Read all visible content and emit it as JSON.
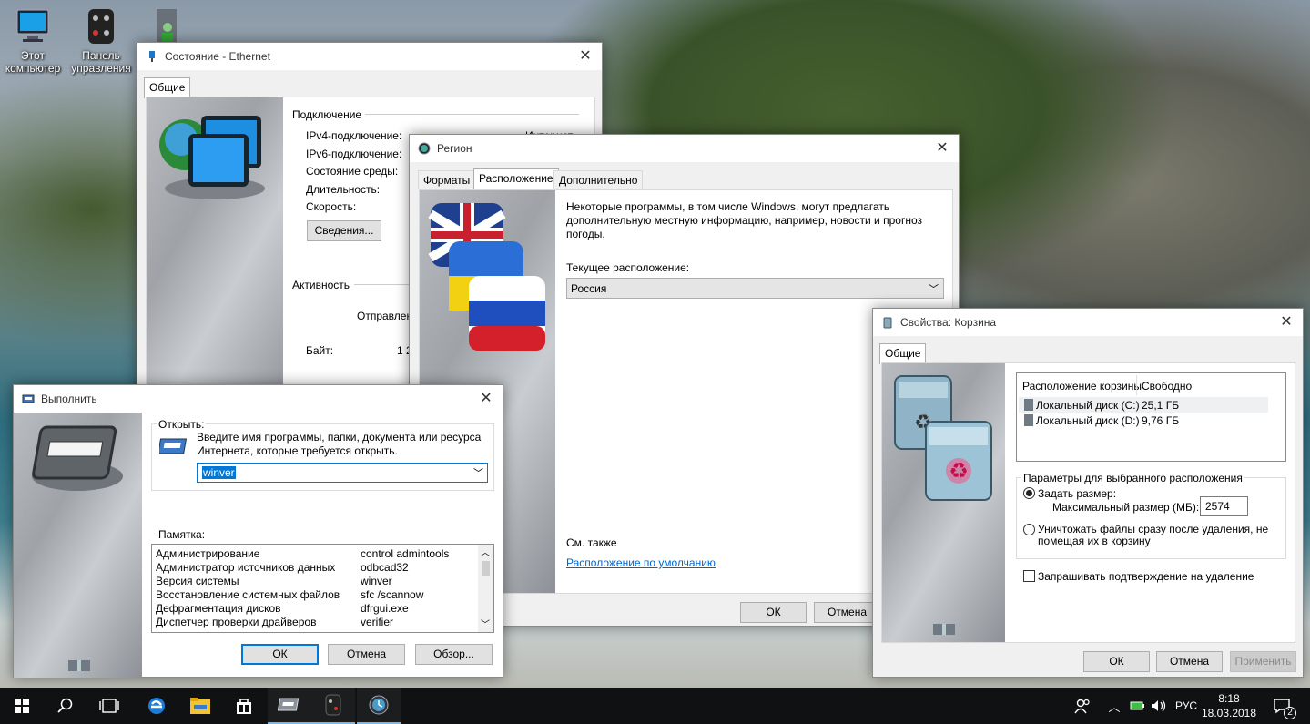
{
  "desktop": {
    "icons": [
      {
        "label": "Этот компьютер"
      },
      {
        "label": "Панель управления"
      },
      {
        "label": ""
      }
    ]
  },
  "ethernet": {
    "title": "Состояние - Ethernet",
    "tab": "Общие",
    "connection_header": "Подключение",
    "rows": [
      {
        "label": "IPv4-подключение:",
        "value": "Интернет"
      },
      {
        "label": "IPv6-подключение:",
        "value": ""
      },
      {
        "label": "Состояние среды:",
        "value": ""
      },
      {
        "label": "Длительность:",
        "value": ""
      },
      {
        "label": "Скорость:",
        "value": ""
      }
    ],
    "details_button": "Сведения...",
    "activity_header": "Активность",
    "sent_label": "Отправлено",
    "bytes_label": "Байт:",
    "bytes_value": "1 2"
  },
  "region": {
    "title": "Регион",
    "tabs": [
      "Форматы",
      "Расположение",
      "Дополнительно"
    ],
    "description": "Некоторые программы, в том числе Windows, могут предлагать дополнительную местную информацию, например, новости и прогноз погоды.",
    "current_location_label": "Текущее расположение:",
    "current_location_value": "Россия",
    "see_also": "См. также",
    "default_location_link": "Расположение по умолчанию",
    "ok": "ОК",
    "cancel": "Отмена"
  },
  "run": {
    "title": "Выполнить",
    "open_group": "Открыть:",
    "prompt": "Введите имя программы, папки, документа или ресурса Интернета, которые требуется открыть.",
    "input_value": "winver",
    "memo_label": "Памятка:",
    "memo_items": [
      {
        "name": "Администрирование",
        "cmd": "control admintools"
      },
      {
        "name": "Администратор источников данных",
        "cmd": "odbcad32"
      },
      {
        "name": "Версия системы",
        "cmd": "winver"
      },
      {
        "name": "Восстановление системных файлов",
        "cmd": "sfc /scannow"
      },
      {
        "name": "Дефрагментация дисков",
        "cmd": "dfrgui.exe"
      },
      {
        "name": "Диспетчер проверки драйверов",
        "cmd": "verifier"
      }
    ],
    "ok": "ОК",
    "cancel": "Отмена",
    "browse": "Обзор..."
  },
  "recycle": {
    "title": "Свойства: Корзина",
    "tab": "Общие",
    "col_location": "Расположение корзины",
    "col_free": "Свободно",
    "drives": [
      {
        "name": "Локальный диск (C:)",
        "free": "25,1 ГБ"
      },
      {
        "name": "Локальный диск (D:)",
        "free": "9,76 ГБ"
      }
    ],
    "params_group": "Параметры для выбранного расположения",
    "set_size": "Задать размер:",
    "max_size_label": "Максимальный размер (МБ):",
    "max_size_value": "2574",
    "delete_now": "Уничтожать файлы сразу после удаления, не помещая их в корзину",
    "confirm_delete": "Запрашивать подтверждение на удаление",
    "ok": "ОК",
    "cancel": "Отмена",
    "apply": "Применить"
  },
  "taskbar": {
    "language": "РУС",
    "time": "8:18",
    "date": "18.03.2018",
    "notifications": "2"
  },
  "colors": {
    "accent": "#0078d7",
    "link": "#0066cc",
    "taskbar": "#0f1113"
  }
}
